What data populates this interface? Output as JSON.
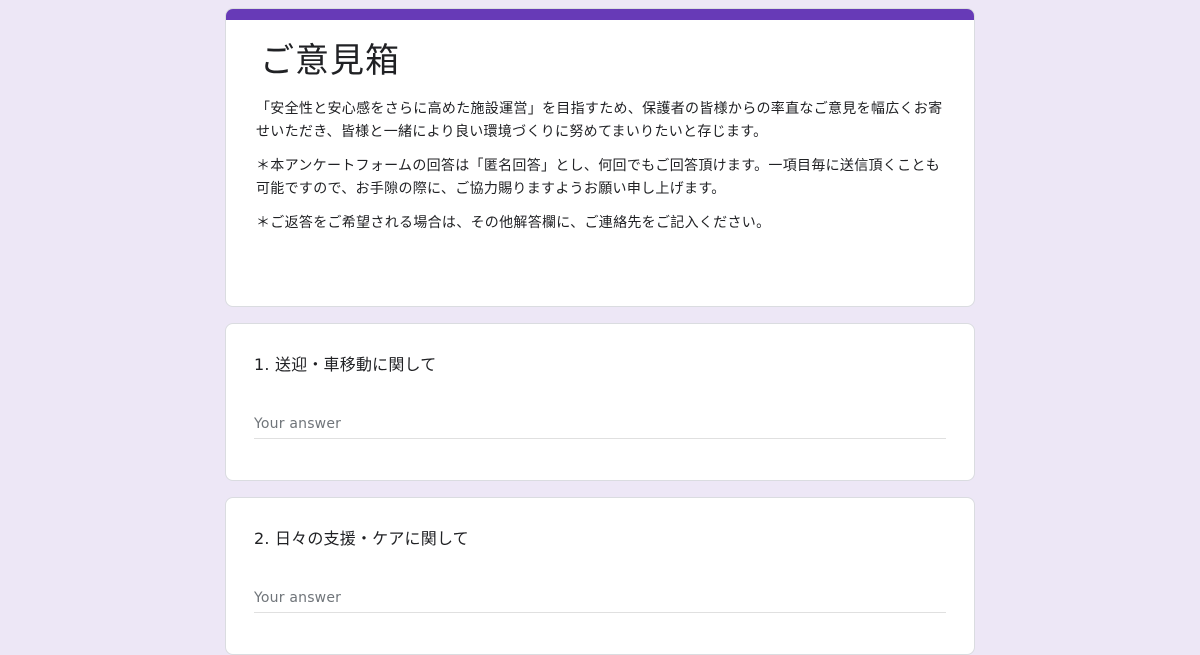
{
  "form": {
    "title": "ご意見箱",
    "description": [
      "「安全性と安心感をさらに高めた施設運営」を目指すため、保護者の皆様からの率直なご意見を幅広くお寄せいただき、皆様と一緒により良い環境づくりに努めてまいりたいと存じます。",
      "＊本アンケートフォームの回答は「匿名回答」とし、何回でもご回答頂けます。一項目毎に送信頂くことも可能ですので、お手隙の際に、ご協力賜りますようお願い申し上げます。",
      "＊ご返答をご希望される場合は、その他解答欄に、ご連絡先をご記入ください。"
    ],
    "accent_color": "#673ab7",
    "background_color": "#ede7f6"
  },
  "questions": [
    {
      "title": "1. 送迎・車移動に関して",
      "placeholder": "Your answer"
    },
    {
      "title": "2. 日々の支援・ケアに関して",
      "placeholder": "Your answer"
    }
  ]
}
